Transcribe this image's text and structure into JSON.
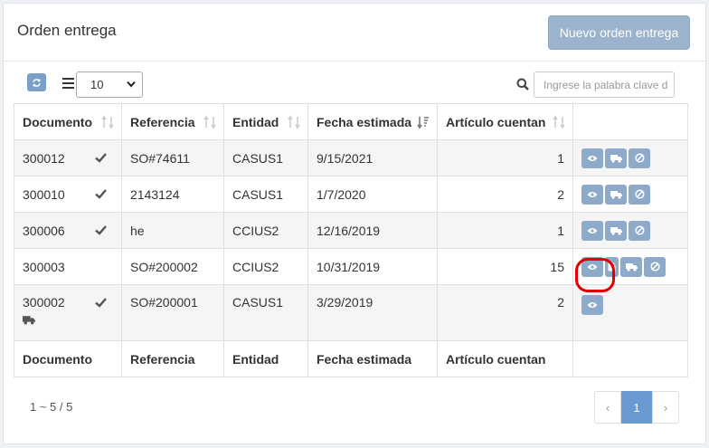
{
  "header": {
    "title": "Orden entrega",
    "new_button": "Nuevo orden entrega"
  },
  "toolbar": {
    "page_size": "10",
    "search_placeholder": "Ingrese la palabra clave d"
  },
  "table": {
    "columns": [
      "Documento",
      "Referencia",
      "Entidad",
      "Fecha estimada",
      "Artículo cuentan"
    ],
    "rows": [
      {
        "documento": "300012",
        "referencia": "SO#74611",
        "entidad": "CASUS1",
        "fecha": "9/15/2021",
        "cuentan": "1",
        "checked": true
      },
      {
        "documento": "300010",
        "referencia": "2143124",
        "entidad": "CASUS1",
        "fecha": "1/7/2020",
        "cuentan": "2",
        "checked": true
      },
      {
        "documento": "300006",
        "referencia": "he",
        "entidad": "CCIUS2",
        "fecha": "12/16/2019",
        "cuentan": "1",
        "checked": true
      },
      {
        "documento": "300003",
        "referencia": "SO#200002",
        "entidad": "CCIUS2",
        "fecha": "10/31/2019",
        "cuentan": "15",
        "checked": false
      },
      {
        "documento": "300002",
        "referencia": "SO#200001",
        "entidad": "CASUS1",
        "fecha": "3/29/2019",
        "cuentan": "2",
        "checked": true
      }
    ]
  },
  "pagination": {
    "summary": "1 ~ 5 / 5",
    "prev": "‹",
    "current": "1",
    "next": "›"
  },
  "icons": {
    "accent": "#8eaacb",
    "highlight": "#e00000"
  }
}
